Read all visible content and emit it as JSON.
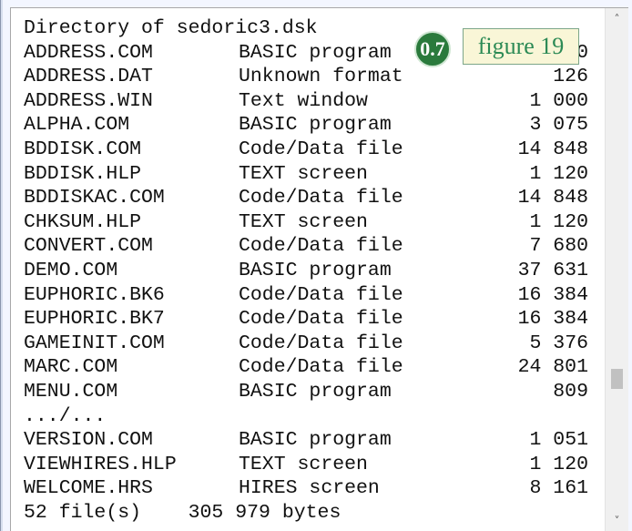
{
  "listing": {
    "header": "Directory of sedoric3.dsk",
    "rows": [
      {
        "name": "ADDRESS.COM",
        "type": "BASIC program",
        "size": "1 000"
      },
      {
        "name": "ADDRESS.DAT",
        "type": "Unknown format",
        "size": "126"
      },
      {
        "name": "ADDRESS.WIN",
        "type": "Text window",
        "size": "1 000"
      },
      {
        "name": "ALPHA.COM",
        "type": "BASIC program",
        "size": "3 075"
      },
      {
        "name": "BDDISK.COM",
        "type": "Code/Data file",
        "size": "14 848"
      },
      {
        "name": "BDDISK.HLP",
        "type": "TEXT screen",
        "size": "1 120"
      },
      {
        "name": "BDDISKAC.COM",
        "type": "Code/Data file",
        "size": "14 848"
      },
      {
        "name": "CHKSUM.HLP",
        "type": "TEXT screen",
        "size": "1 120"
      },
      {
        "name": "CONVERT.COM",
        "type": "Code/Data file",
        "size": "7 680"
      },
      {
        "name": "DEMO.COM",
        "type": "BASIC program",
        "size": "37 631"
      },
      {
        "name": "EUPHORIC.BK6",
        "type": "Code/Data file",
        "size": "16 384"
      },
      {
        "name": "EUPHORIC.BK7",
        "type": "Code/Data file",
        "size": "16 384"
      },
      {
        "name": "GAMEINIT.COM",
        "type": "Code/Data file",
        "size": "5 376"
      },
      {
        "name": "MARC.COM",
        "type": "Code/Data file",
        "size": "24 801"
      },
      {
        "name": "MENU.COM",
        "type": "BASIC program",
        "size": "809"
      }
    ],
    "ellipsis": ".../...",
    "rows_after": [
      {
        "name": "VERSION.COM",
        "type": "BASIC program",
        "size": "1 051"
      },
      {
        "name": "VIEWHIRES.HLP",
        "type": "TEXT screen",
        "size": "1 120"
      },
      {
        "name": "WELCOME.HRS",
        "type": "HIRES screen",
        "size": "8 161"
      }
    ],
    "footer": "52 file(s)    305 979 bytes"
  },
  "overlay": {
    "badge": "0.7",
    "figure_label": "figure 19"
  },
  "scrollbar": {
    "up_icon": "chevron-up-icon",
    "down_icon": "chevron-down-icon"
  },
  "colors": {
    "badge_bg": "#2a7a3c",
    "figure_text": "#2c8a55",
    "figure_bg": "#f9f6d7"
  }
}
